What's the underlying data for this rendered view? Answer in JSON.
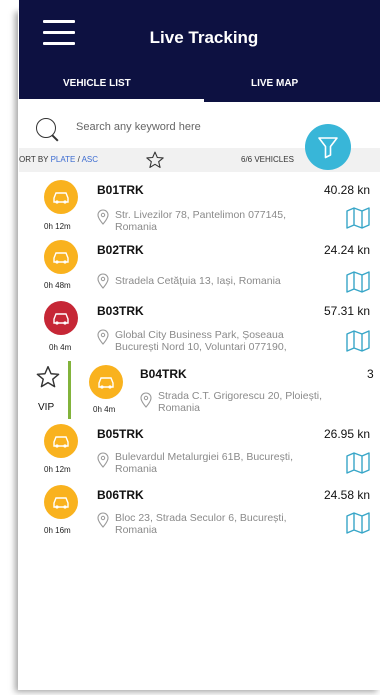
{
  "header": {
    "title": "Live Tracking"
  },
  "tabs": [
    {
      "label": "VEHICLE LIST",
      "active": true
    },
    {
      "label": "LIVE MAP",
      "active": false
    }
  ],
  "search": {
    "placeholder": "Search any keyword here"
  },
  "sort": {
    "prefix": "ORT BY",
    "field": "PLATE",
    "separator": "/",
    "order": "ASC"
  },
  "vehicle_count": "6/6 VEHICLES",
  "vip_label": "VIP",
  "colors": {
    "header": "#0d1141",
    "accent": "#38b6d8",
    "status_idle": "#f9b21e",
    "status_alert": "#c62736",
    "vip_bar": "#82b33b"
  },
  "vehicles": [
    {
      "plate": "B01TRK",
      "distance": "40.28 kn",
      "duration": "0h 12m",
      "address": [
        "Str. Livezilor 78, Pantelimon 077145,",
        "Romania"
      ],
      "status": "idle"
    },
    {
      "plate": "B02TRK",
      "distance": "24.24 kn",
      "duration": "0h 48m",
      "address": [
        "Stradela Cetățuia 13, Iași, Romania"
      ],
      "status": "idle"
    },
    {
      "plate": "B03TRK",
      "distance": "57.31 kn",
      "duration": "0h 4m",
      "address": [
        "Global City Business Park, Șoseaua",
        "București Nord 10, Voluntari 077190,"
      ],
      "status": "alert"
    },
    {
      "plate": "B04TRK",
      "distance": "3",
      "duration": "0h 4m",
      "address": [
        "Strada C.T. Grigorescu 20, Ploiești,",
        "Romania"
      ],
      "status": "idle"
    },
    {
      "plate": "B05TRK",
      "distance": "26.95 kn",
      "duration": "0h 12m",
      "address": [
        "Bulevardul Metalurgiei 61B, București,",
        "Romania"
      ],
      "status": "idle"
    },
    {
      "plate": "B06TRK",
      "distance": "24.58 kn",
      "duration": "0h 16m",
      "address": [
        "Bloc 23, Strada Seculor 6, București,",
        "Romania"
      ],
      "status": "idle"
    }
  ]
}
